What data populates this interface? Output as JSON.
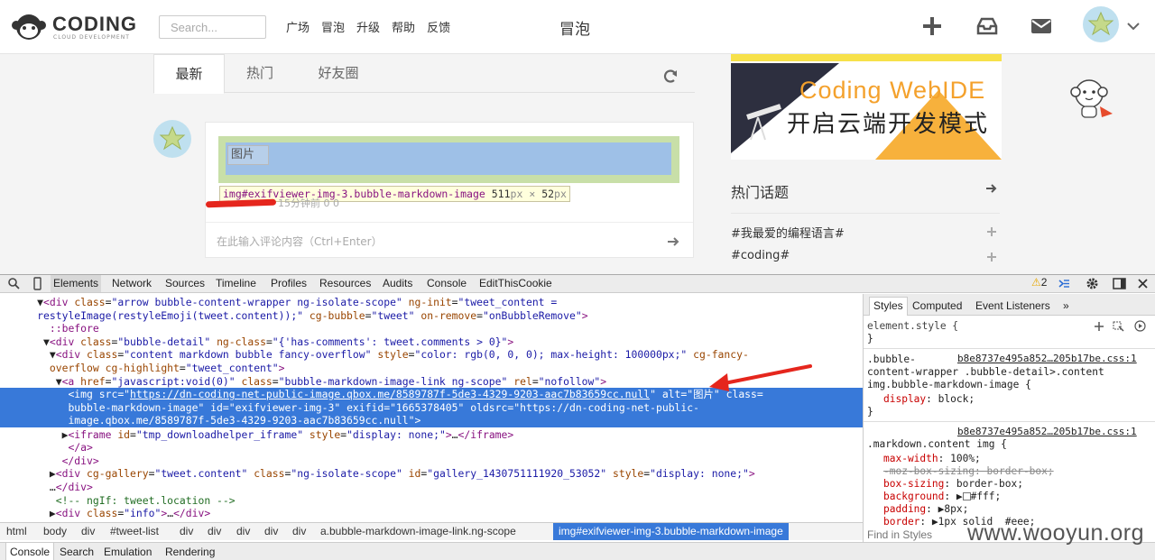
{
  "nav": {
    "logo_text": "CODING",
    "logo_sub": "CLOUD DEVELOPMENT",
    "search_placeholder": "Search...",
    "links": [
      "广场",
      "冒泡",
      "升级",
      "帮助",
      "反馈"
    ],
    "page_title": "冒泡"
  },
  "feed": {
    "tabs": [
      "最新",
      "热门",
      "好友圈"
    ],
    "active_tab": "最新",
    "image_alt": "图片",
    "tooltip": {
      "selector": "img#exifviewer-img-3.bubble-markdown-image",
      "width": "511",
      "height": "52",
      "unit": "px",
      "times": "×"
    },
    "meta": "15分钟前   0   0",
    "comment_placeholder": "在此输入评论内容（Ctrl+Enter）"
  },
  "sidebar": {
    "banner_line1": "Coding  WebIDE",
    "banner_line2": "开启云端开发模式",
    "hot_title": "热门话题",
    "topics": [
      "#我最爱的编程语言#",
      "#coding#"
    ]
  },
  "devtools": {
    "tabs": [
      "Elements",
      "Network",
      "Sources",
      "Timeline",
      "Profiles",
      "Resources",
      "Audits",
      "Console",
      "EditThisCookie"
    ],
    "active_tab": "Elements",
    "warnings": "2",
    "breadcrumbs": [
      "html",
      "body",
      "div",
      "#tweet-list",
      "div",
      "div",
      "div",
      "div",
      "a.bubble-markdown-image-link.ng-scope",
      "img#exifviewer-img-3.bubble-markdown-image"
    ],
    "drawer_tabs": [
      "Console",
      "Search",
      "Emulation",
      "Rendering"
    ],
    "styles_tabs": [
      "Styles",
      "Computed",
      "Event Listeners",
      "»"
    ],
    "find_placeholder": "Find in Styles",
    "styles": {
      "element_style": "element.style {",
      "rule1_src": "b8e8737e495a852…205b17be.css:1",
      "rule1_sel1": ".bubble-",
      "rule1_sel2": "content-wrapper .bubble-detail>.content",
      "rule1_sel3": "img.bubble-markdown-image {",
      "rule1_prop": "display",
      "rule1_val": "block;",
      "rule2_src": "b8e8737e495a852…205b17be.css:1",
      "rule2_sel": ".markdown.content img {",
      "props": [
        {
          "name": "max-width",
          "value": "100%;"
        },
        {
          "name": "-moz-box-sizing",
          "value": "border-box;"
        },
        {
          "name": "box-sizing",
          "value": "border-box;"
        },
        {
          "name": "background",
          "value": "#fff;"
        },
        {
          "name": "padding",
          "value": "8px;"
        },
        {
          "name": "border",
          "value": "1px solid  #eee;"
        }
      ]
    }
  },
  "watermark": "www.wooyun.org",
  "colors": {
    "selection": "#3879d9",
    "tag": "#881280",
    "attr": "#994500",
    "value": "#1a1aa6",
    "banner_orange": "#f4a12c"
  }
}
